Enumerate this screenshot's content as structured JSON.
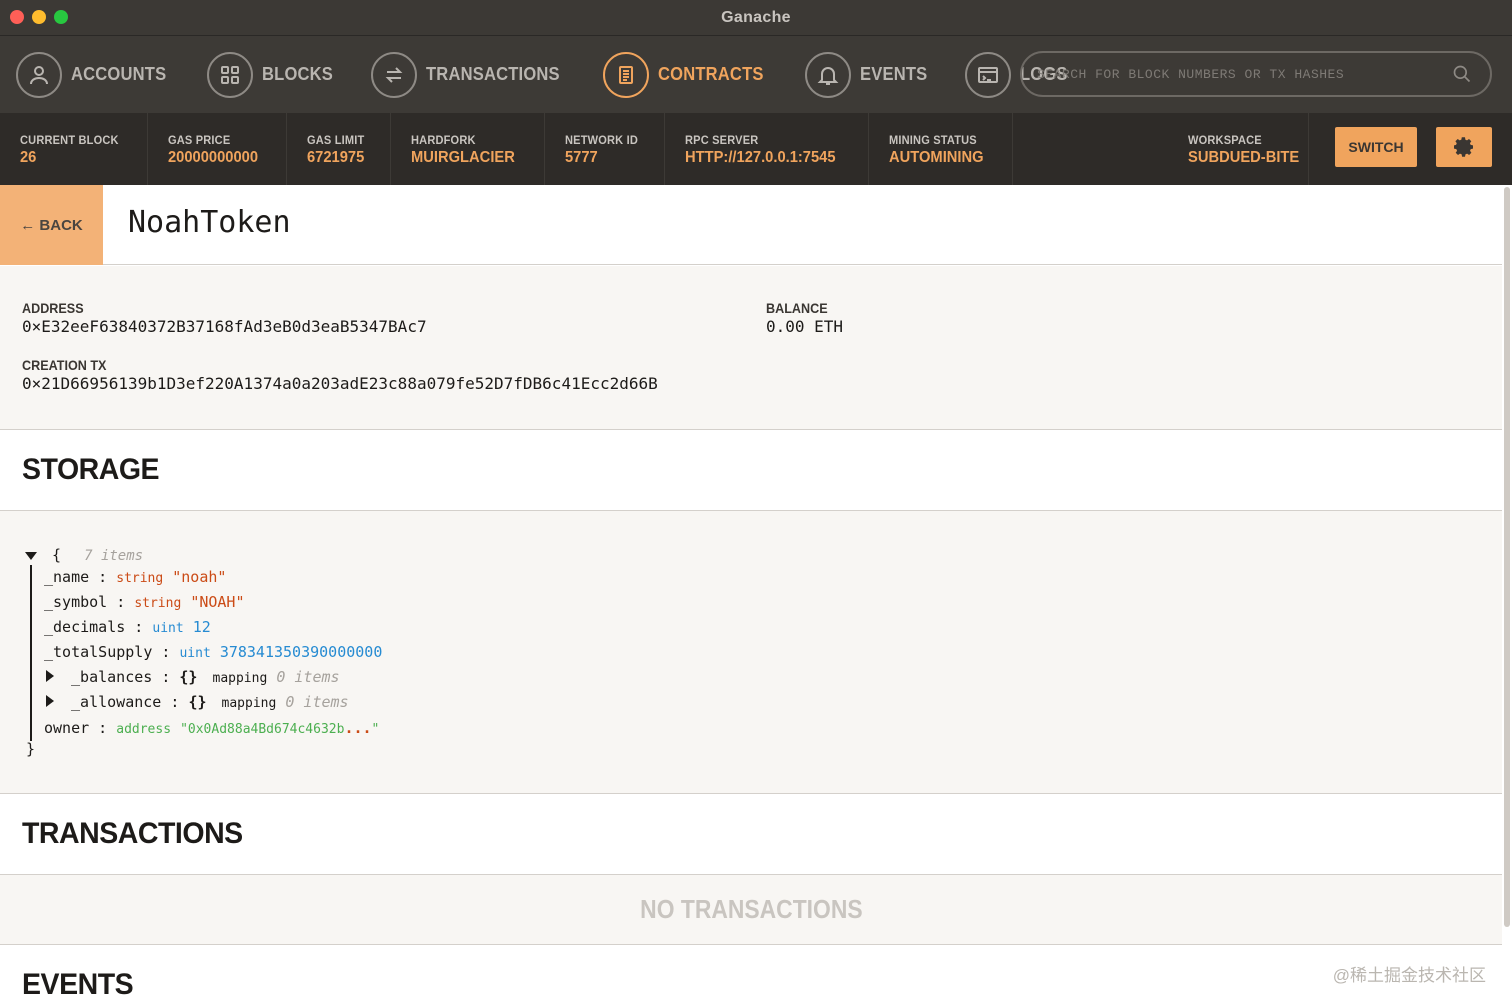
{
  "window": {
    "title": "Ganache"
  },
  "nav": {
    "items": [
      {
        "label": "ACCOUNTS",
        "icon": "user-icon"
      },
      {
        "label": "BLOCKS",
        "icon": "grid-icon"
      },
      {
        "label": "TRANSACTIONS",
        "icon": "transfer-icon"
      },
      {
        "label": "CONTRACTS",
        "icon": "document-icon"
      },
      {
        "label": "EVENTS",
        "icon": "bell-icon"
      },
      {
        "label": "LOGS",
        "icon": "terminal-icon"
      }
    ],
    "active": "CONTRACTS",
    "search_placeholder": "SEARCH FOR BLOCK NUMBERS OR TX HASHES"
  },
  "status": {
    "current_block": {
      "label": "CURRENT BLOCK",
      "value": "26"
    },
    "gas_price": {
      "label": "GAS PRICE",
      "value": "20000000000"
    },
    "gas_limit": {
      "label": "GAS LIMIT",
      "value": "6721975"
    },
    "hardfork": {
      "label": "HARDFORK",
      "value": "MUIRGLACIER"
    },
    "network_id": {
      "label": "NETWORK ID",
      "value": "5777"
    },
    "rpc_server": {
      "label": "RPC SERVER",
      "value": "HTTP://127.0.0.1:7545"
    },
    "mining_status": {
      "label": "MINING STATUS",
      "value": "AUTOMINING"
    },
    "workspace": {
      "label": "WORKSPACE",
      "value": "SUBDUED-BITE"
    },
    "switch_label": "SWITCH"
  },
  "contract": {
    "back_label": "← BACK",
    "name": "NoahToken",
    "address_label": "ADDRESS",
    "address": "0×E32eeF63840372B37168fAd3eB0d3eaB5347BAc7",
    "balance_label": "BALANCE",
    "balance": "0.00 ETH",
    "creation_tx_label": "CREATION TX",
    "creation_tx": "0×21D66956139b1D3ef220A1374a0a203adE23c88a079fe52D7fDB6c41Ecc2d66B"
  },
  "storage": {
    "title": "STORAGE",
    "open_brace": "{",
    "item_count": "7 items",
    "close_brace": "}",
    "fields": {
      "name": {
        "key": "_name",
        "type": "string",
        "value": "\"noah\""
      },
      "symbol": {
        "key": "_symbol",
        "type": "string",
        "value": "\"NOAH\""
      },
      "decimals": {
        "key": "_decimals",
        "type": "uint",
        "value": "12"
      },
      "total_supply": {
        "key": "_totalSupply",
        "type": "uint",
        "value": "378341350390000000"
      },
      "balances": {
        "key": "_balances",
        "braces": "{}",
        "type": "mapping",
        "count": "0 items"
      },
      "allowance": {
        "key": "_allowance",
        "braces": "{}",
        "type": "mapping",
        "count": "0 items"
      },
      "owner": {
        "key": "owner",
        "type": "address",
        "value": "\"0x0Ad88a4Bd674c4632b",
        "ellipsis": "...",
        "end_quote": "\""
      }
    }
  },
  "transactions": {
    "title": "TRANSACTIONS",
    "empty": "NO TRANSACTIONS"
  },
  "events": {
    "title": "EVENTS"
  },
  "watermark": "@稀土掘金技术社区",
  "colors": {
    "accent": "#f0a45d",
    "header_bg": "#3d3a36",
    "status_bg": "#2e2b28"
  }
}
